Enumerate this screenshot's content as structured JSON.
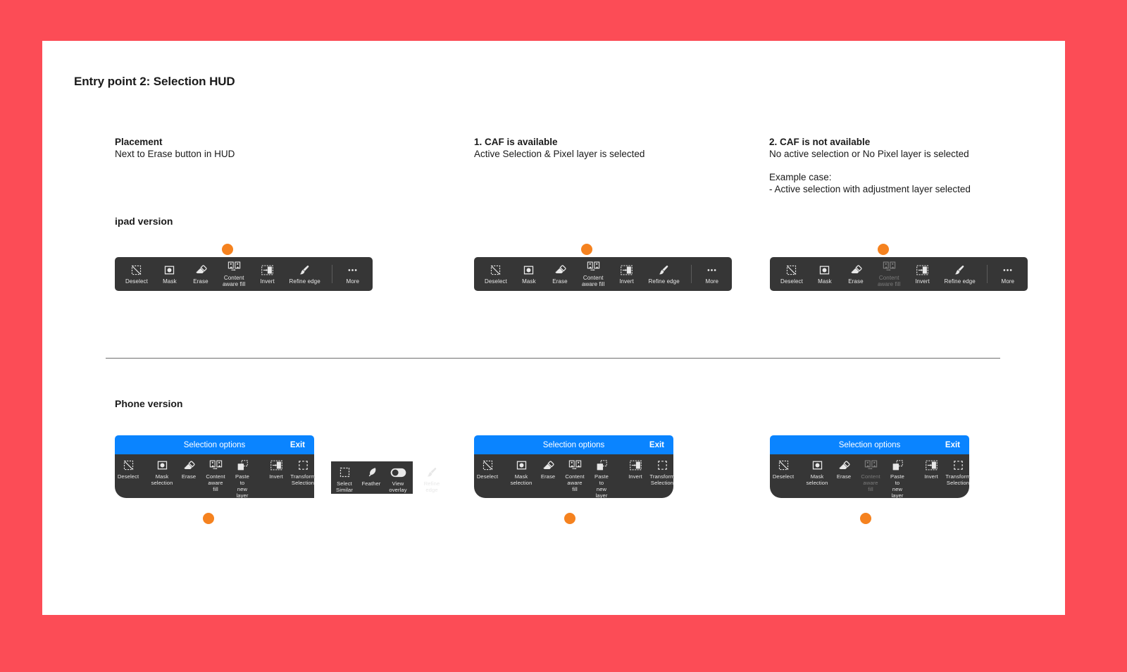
{
  "page": {
    "title": "Entry point 2: Selection HUD",
    "background_color": "#fc4c56",
    "canvas_color": "#ffffff",
    "accent_dot_color": "#f5821f",
    "hud_color": "#363636",
    "phone_header_color": "#0a84ff"
  },
  "columns": [
    {
      "title": "Placement",
      "subtitle": "Next to Erase button in HUD",
      "extra_title": "",
      "extra_subtitle": ""
    },
    {
      "title": "1. CAF is available",
      "subtitle": "Active Selection & Pixel layer is selected",
      "extra_title": "",
      "extra_subtitle": ""
    },
    {
      "title": "2. CAF is not available",
      "subtitle": "No active selection or No Pixel layer is selected",
      "extra_title": "Example case:",
      "extra_subtitle": "- Active selection with adjustment layer selected"
    }
  ],
  "sections": {
    "ipad_label": "ipad version",
    "phone_label": "Phone version"
  },
  "ipad_huds": [
    {
      "id": "ipad-hud-placement",
      "items": [
        {
          "label": "Deselect",
          "icon": "deselect-icon",
          "disabled": false
        },
        {
          "label": "Mask",
          "icon": "mask-icon",
          "disabled": false
        },
        {
          "label": "Erase",
          "icon": "erase-icon",
          "disabled": false
        },
        {
          "label": "Content\naware fill",
          "icon": "content-aware-fill-icon",
          "disabled": false
        },
        {
          "label": "Invert",
          "icon": "invert-icon",
          "disabled": false
        },
        {
          "label": "Refine edge",
          "icon": "refine-edge-icon",
          "disabled": false
        },
        {
          "label": "More",
          "icon": "more-icon",
          "disabled": false
        }
      ],
      "separator_before": "More"
    },
    {
      "id": "ipad-hud-caf-available",
      "items": [
        {
          "label": "Deselect",
          "icon": "deselect-icon",
          "disabled": false
        },
        {
          "label": "Mask",
          "icon": "mask-icon",
          "disabled": false
        },
        {
          "label": "Erase",
          "icon": "erase-icon",
          "disabled": false
        },
        {
          "label": "Content\naware fill",
          "icon": "content-aware-fill-icon",
          "disabled": false
        },
        {
          "label": "Invert",
          "icon": "invert-icon",
          "disabled": false
        },
        {
          "label": "Refine edge",
          "icon": "refine-edge-icon",
          "disabled": false
        },
        {
          "label": "More",
          "icon": "more-icon",
          "disabled": false
        }
      ],
      "separator_before": "More"
    },
    {
      "id": "ipad-hud-caf-unavailable",
      "items": [
        {
          "label": "Deselect",
          "icon": "deselect-icon",
          "disabled": false
        },
        {
          "label": "Mask",
          "icon": "mask-icon",
          "disabled": false
        },
        {
          "label": "Erase",
          "icon": "erase-icon",
          "disabled": false
        },
        {
          "label": "Content\naware fill",
          "icon": "content-aware-fill-icon",
          "disabled": true
        },
        {
          "label": "Invert",
          "icon": "invert-icon",
          "disabled": false
        },
        {
          "label": "Refine edge",
          "icon": "refine-edge-icon",
          "disabled": false
        },
        {
          "label": "More",
          "icon": "more-icon",
          "disabled": false
        }
      ],
      "separator_before": "More"
    }
  ],
  "phone_panels": [
    {
      "id": "phone-panel-placement",
      "header_title": "Selection options",
      "exit_label": "Exit",
      "items": [
        {
          "label": "Deselect",
          "icon": "deselect-icon",
          "disabled": false
        },
        {
          "label": "Mask\nselection",
          "icon": "mask-icon",
          "disabled": false
        },
        {
          "label": "Erase",
          "icon": "erase-icon",
          "disabled": false
        },
        {
          "label": "Content\naware fill",
          "icon": "content-aware-fill-icon",
          "disabled": false
        },
        {
          "label": "Paste to\nnew layer",
          "icon": "paste-to-new-layer-icon",
          "disabled": false
        },
        {
          "label": "Invert",
          "icon": "invert-icon",
          "disabled": false
        },
        {
          "label": "Transform\nSelection",
          "icon": "transform-selection-icon",
          "disabled": false
        }
      ],
      "overflow_items": [
        {
          "label": "Select\nSimilar",
          "icon": "select-similar-icon",
          "disabled": false
        },
        {
          "label": "Feather",
          "icon": "feather-icon",
          "disabled": false
        },
        {
          "label": "View\noverlay",
          "icon": "view-overlay-toggle-icon",
          "disabled": false
        },
        {
          "label": "Refine\nedge",
          "icon": "refine-edge-icon",
          "disabled": false
        }
      ]
    },
    {
      "id": "phone-panel-caf-available",
      "header_title": "Selection options",
      "exit_label": "Exit",
      "items": [
        {
          "label": "Deselect",
          "icon": "deselect-icon",
          "disabled": false
        },
        {
          "label": "Mask\nselection",
          "icon": "mask-icon",
          "disabled": false
        },
        {
          "label": "Erase",
          "icon": "erase-icon",
          "disabled": false
        },
        {
          "label": "Content\naware fill",
          "icon": "content-aware-fill-icon",
          "disabled": false
        },
        {
          "label": "Paste to\nnew layer",
          "icon": "paste-to-new-layer-icon",
          "disabled": false
        },
        {
          "label": "Invert",
          "icon": "invert-icon",
          "disabled": false
        },
        {
          "label": "Transform\nSelection",
          "icon": "transform-selection-icon",
          "disabled": false
        }
      ],
      "overflow_items": []
    },
    {
      "id": "phone-panel-caf-unavailable",
      "header_title": "Selection options",
      "exit_label": "Exit",
      "items": [
        {
          "label": "Deselect",
          "icon": "deselect-icon",
          "disabled": false
        },
        {
          "label": "Mask\nselection",
          "icon": "mask-icon",
          "disabled": false
        },
        {
          "label": "Erase",
          "icon": "erase-icon",
          "disabled": false
        },
        {
          "label": "Content\naware fill",
          "icon": "content-aware-fill-icon",
          "disabled": true
        },
        {
          "label": "Paste to\nnew layer",
          "icon": "paste-to-new-layer-icon",
          "disabled": false
        },
        {
          "label": "Invert",
          "icon": "invert-icon",
          "disabled": false
        },
        {
          "label": "Transform\nSelection",
          "icon": "transform-selection-icon",
          "disabled": false
        }
      ],
      "overflow_items": []
    }
  ]
}
